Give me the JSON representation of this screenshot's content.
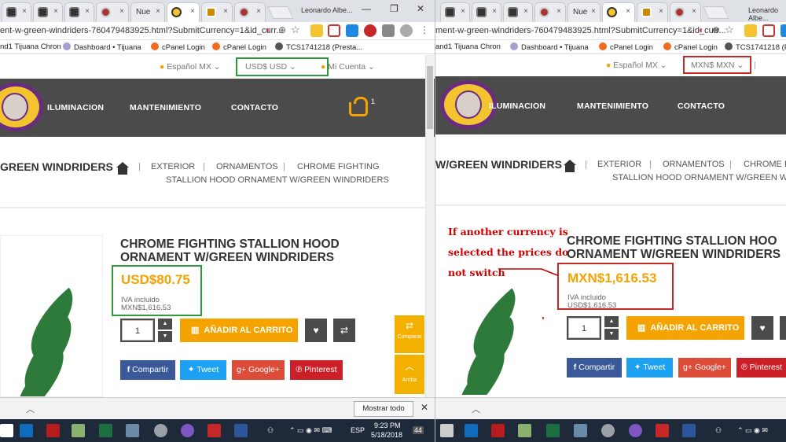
{
  "left": {
    "tabs": [
      "",
      "",
      "",
      "",
      "Nue",
      "",
      "",
      "",
      ""
    ],
    "window_title": "Leonardo Albe...",
    "url": "ent-w-green-windriders-760479483925.html?SubmitCurrency=1&id_curr...",
    "bookmarks": [
      "nd1 Tijuana Chron",
      "Dashboard • Tijuana",
      "cPanel Login",
      "cPanel Login",
      "TCS1741218 (Presta..."
    ],
    "lang": "Español MX",
    "currency": "USD$ USD",
    "account": "Mi Cuenta",
    "nav": [
      "ILUMINACION",
      "MANTENIMIENTO",
      "CONTACTO"
    ],
    "cart_count": "1",
    "breadcrumb_title": "GREEN WINDRIDERS",
    "crumb_exterior": "EXTERIOR",
    "crumb_ornamentos": "ORNAMENTOS",
    "crumb_chrome": "CHROME FIGHTING",
    "crumb_line2": "STALLION HOOD ORNAMENT W/GREEN WINDRIDERS",
    "product_title_1": "CHROME FIGHTING STALLION HOOD",
    "product_title_2": "ORNAMENT W/GREEN WINDRIDERS",
    "price": "USD$80.75",
    "tax": "IVA incluido",
    "alt_price": "MXN$1,616.53",
    "qty": "1",
    "add_to_cart": "AÑADIR AL CARRITO",
    "facebook": "Compartir",
    "twitter": "Tweet",
    "google": "Google+",
    "pinterest": "Pinterest",
    "compare": "Comparar",
    "top": "Arriba",
    "show_all": "Mostrar todo"
  },
  "right": {
    "tabs": [
      "",
      "",
      "",
      "Nue",
      "",
      "",
      "",
      ""
    ],
    "window_title": "Leonardo Albe...",
    "url": "ment-w-green-windriders-760479483925.html?SubmitCurrency=1&id_curr...",
    "bookmarks": [
      "and1 Tijuana Chron",
      "Dashboard • Tijuana",
      "cPanel Login",
      "cPanel Login",
      "TCS1741218 (Presta..."
    ],
    "lang": "Español MX",
    "currency": "MXN$ MXN",
    "nav": [
      "ILUMINACION",
      "MANTENIMIENTO",
      "CONTACTO"
    ],
    "breadcrumb_title": "W/GREEN WINDRIDERS",
    "crumb_exterior": "EXTERIOR",
    "crumb_ornamentos": "ORNAMENTOS",
    "crumb_chrome": "CHROME F",
    "crumb_line2": "STALLION HOOD ORNAMENT W/GREEN WI",
    "product_title_1": "CHROME FIGHTING STALLION HOO",
    "product_title_2": "ORNAMENT W/GREEN WINDRIDERS",
    "price": "MXN$1,616.53",
    "tax": "IVA incluido",
    "alt_price": "USD$1,616.53",
    "qty": "1",
    "add_to_cart": "AÑADIR AL CARRITO",
    "facebook": "Compartir",
    "twitter": "Tweet",
    "google": "Google+",
    "pinterest": "Pinterest",
    "annotation": [
      "If another currency is",
      "selected the prices do",
      "not switch"
    ]
  },
  "taskbar": {
    "lang": "ESP",
    "time": "9:23 PM",
    "date": "5/18/2018",
    "notifications": "44"
  },
  "colors": {
    "accent": "#f4a300",
    "nav_bg": "#4b4b4b",
    "highlight_good": "#2e9a3e",
    "highlight_bad": "#c62828",
    "facebook": "#3b5998",
    "twitter": "#1da1f2",
    "google": "#dd4b39",
    "pinterest": "#cb2027"
  }
}
